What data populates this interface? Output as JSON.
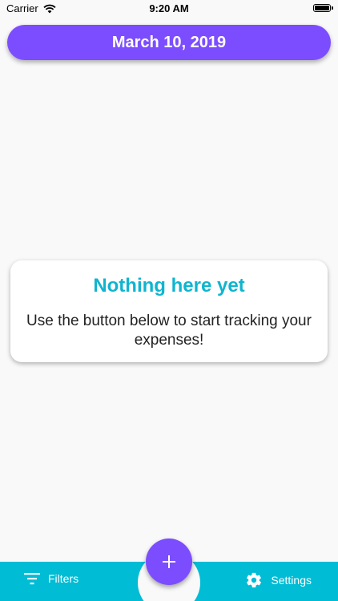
{
  "status_bar": {
    "carrier": "Carrier",
    "time": "9:20 AM",
    "wifi_icon": "wifi-icon",
    "battery_icon": "battery-icon"
  },
  "header": {
    "date": "March 10, 2019"
  },
  "empty_state": {
    "title": "Nothing here yet",
    "message": "Use the button below to start tracking your expenses!"
  },
  "bottom_bar": {
    "filters_label": "Filters",
    "filters_icon": "filter-icon",
    "settings_label": "Settings",
    "settings_icon": "gear-icon",
    "add_icon": "plus-icon"
  },
  "colors": {
    "primary": "#7c4dff",
    "accent": "#00bcd4",
    "title": "#0fb5cf",
    "background": "#f9f9f9"
  }
}
